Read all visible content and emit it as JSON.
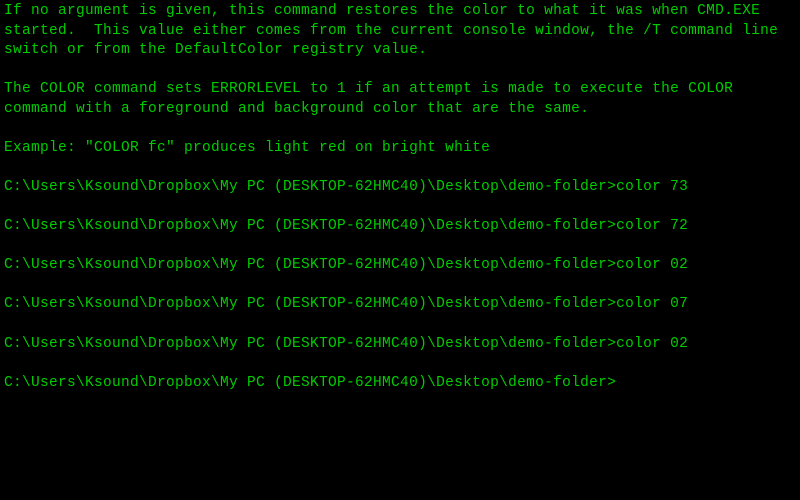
{
  "help_text": {
    "para1": "If no argument is given, this command restores the color to what it was when CMD.EXE started.  This value either comes from the current console window, the /T command line switch or from the DefaultColor registry value.",
    "para2": "The COLOR command sets ERRORLEVEL to 1 if an attempt is made to execute the COLOR command with a foreground and background color that are the same.",
    "example": "Example: \"COLOR fc\" produces light red on bright white"
  },
  "prompt_path": "C:\\Users\\Ksound\\Dropbox\\My PC (DESKTOP-62HMC40)\\Desktop\\demo-folder>",
  "history": [
    {
      "command": "color 73"
    },
    {
      "command": "color 72"
    },
    {
      "command": "color 02"
    },
    {
      "command": "color 07"
    },
    {
      "command": "color 02"
    }
  ],
  "current_command": ""
}
